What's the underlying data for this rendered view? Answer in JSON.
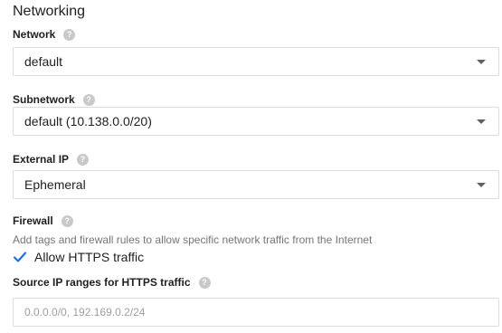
{
  "section": {
    "title": "Networking"
  },
  "network": {
    "label": "Network",
    "value": "default"
  },
  "subnetwork": {
    "label": "Subnetwork",
    "value": "default (10.138.0.0/20)"
  },
  "external_ip": {
    "label": "External IP",
    "value": "Ephemeral"
  },
  "firewall": {
    "label": "Firewall",
    "description": "Add tags and firewall rules to allow specific network traffic from the Internet",
    "allow_https": {
      "label": "Allow HTTPS traffic",
      "checked": true
    }
  },
  "source_ip": {
    "label": "Source IP ranges for HTTPS traffic",
    "placeholder": "0.0.0.0/0, 192.169.0.2/24"
  },
  "help_glyph": "?",
  "colors": {
    "accent": "#1a73e8",
    "help_icon": "#c9c9c9",
    "border": "#dadce0"
  }
}
